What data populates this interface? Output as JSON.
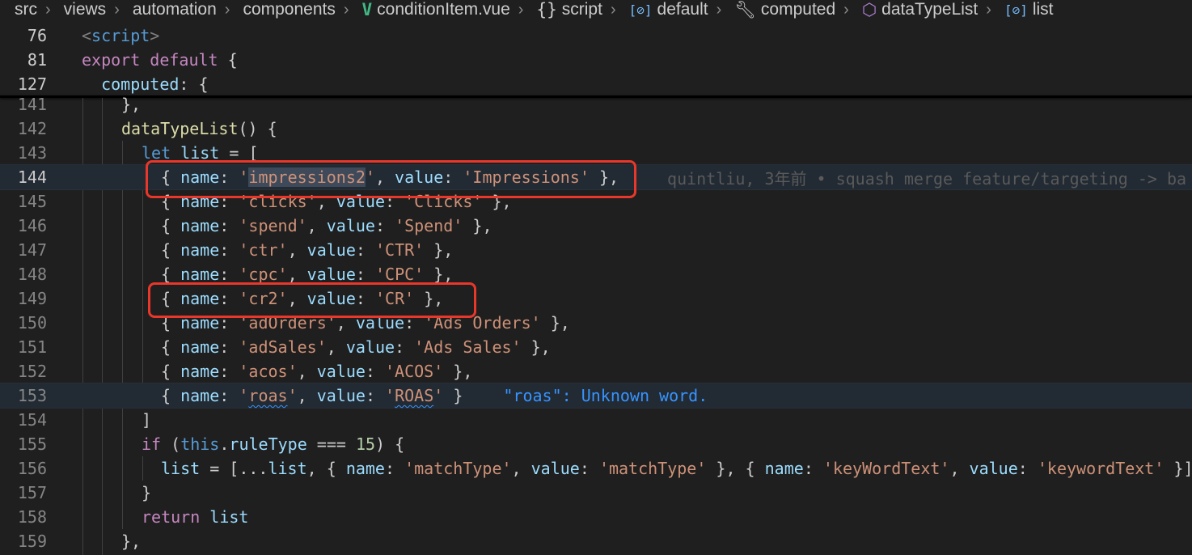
{
  "breadcrumb": [
    {
      "label": "src",
      "icon": ""
    },
    {
      "label": "views",
      "icon": ""
    },
    {
      "label": "automation",
      "icon": ""
    },
    {
      "label": "components",
      "icon": ""
    },
    {
      "label": "conditionItem.vue",
      "icon": "vue-icon"
    },
    {
      "label": "script",
      "icon": "braces-icon"
    },
    {
      "label": "default",
      "icon": "symbol-variable-icon"
    },
    {
      "label": "computed",
      "icon": "wrench-icon"
    },
    {
      "label": "dataTypeList",
      "icon": "cube-icon"
    },
    {
      "label": "list",
      "icon": "symbol-variable-icon"
    }
  ],
  "sticky": {
    "l76": "76",
    "c76a": "<",
    "c76b": "script",
    "c76c": ">",
    "l81": "81",
    "c81a": "export",
    "c81b": " default",
    "c81c": " {",
    "l127": "127",
    "c127a": "  computed",
    "c127b": ": {"
  },
  "lines": {
    "l141": "141",
    "l142": "142",
    "l143": "143",
    "l144": "144",
    "l145": "145",
    "l146": "146",
    "l147": "147",
    "l148": "148",
    "l149": "149",
    "l150": "150",
    "l151": "151",
    "l152": "152",
    "l153": "153",
    "l154": "154",
    "l155": "155",
    "l156": "156",
    "l157": "157",
    "l158": "158",
    "l159": "159"
  },
  "code": {
    "c141": "},",
    "c142a": "dataTypeList",
    "c142b": "() {",
    "c143a": "let",
    "c143b": " list",
    "c143c": " = [",
    "k_name": "name",
    "k_value": "value",
    "s144n": "impressions2",
    "s144v": "'Impressions'",
    "s145n": "'clicks'",
    "s145v": "'Clicks'",
    "s146n": "'spend'",
    "s146v": "'Spend'",
    "s147n": "'ctr'",
    "s147v": "'CTR'",
    "s148n": "'cpc'",
    "s148v": "'CPC'",
    "s149n": "'cr2'",
    "s149v": "'CR'",
    "s150n": "'adOrders'",
    "s150v": "'Ads Orders'",
    "s151n": "'adSales'",
    "s151v": "'Ads Sales'",
    "s152n": "'acos'",
    "s152v": "'ACOS'",
    "s153n": "roas",
    "s153v": "ROAS",
    "c154": "]",
    "c155a": "if",
    "c155b": " (",
    "c155c": "this",
    "c155d": ".",
    "c155e": "ruleType",
    "c155f": " === ",
    "c155g": "15",
    "c155h": ") {",
    "c156a": "list",
    "c156b": " = [...",
    "c156c": "list",
    "c156d": ", { ",
    "s156a": "'matchType'",
    "s156b": "'matchType'",
    "s156c": "'keyWordText'",
    "s156d": "'keywordText'",
    "c157": "}",
    "c158a": "return",
    "c158b": " list",
    "c159": "},"
  },
  "blame_144": "quintliu, 3年前 • squash merge feature/targeting -> ba",
  "diag_153": "\"roas\": Unknown word.",
  "colors": {
    "highlight_box": "#e8372b",
    "background": "#1f1f1f",
    "diagnostic": "#3794ff"
  }
}
